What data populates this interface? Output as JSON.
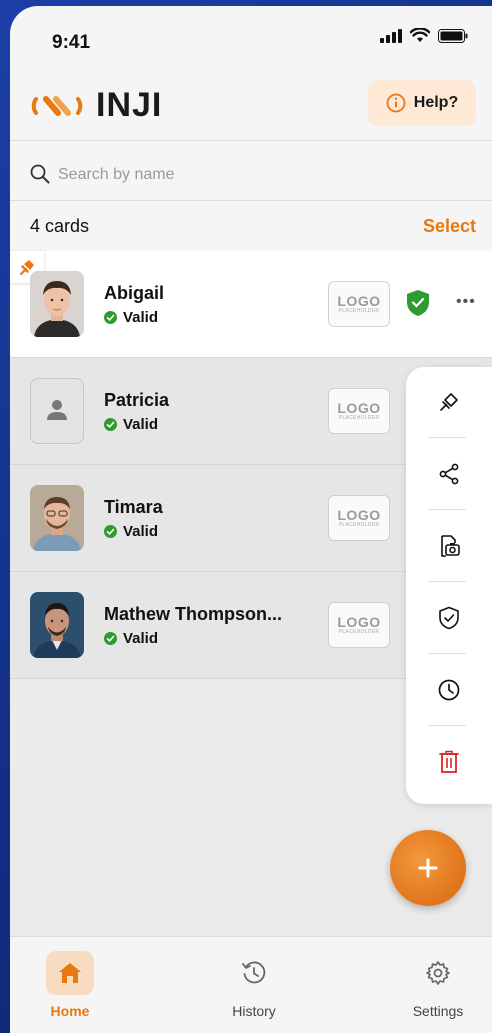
{
  "status_bar": {
    "time": "9:41"
  },
  "header": {
    "logo_text": "INJI",
    "help_label": "Help?"
  },
  "search": {
    "placeholder": "Search by name"
  },
  "cards_bar": {
    "count_label": "4 cards",
    "select_label": "Select"
  },
  "cards": [
    {
      "name": "Abigail",
      "status": "Valid",
      "logo_big": "LOGO",
      "logo_small": "PLACEHOLDER"
    },
    {
      "name": "Patricia",
      "status": "Valid",
      "logo_big": "LOGO",
      "logo_small": "PLACEHOLDER"
    },
    {
      "name": "Timara",
      "status": "Valid",
      "logo_big": "LOGO",
      "logo_small": "PLACEHOLDER"
    },
    {
      "name": "Mathew Thompson...",
      "status": "Valid",
      "logo_big": "LOGO",
      "logo_small": "PLACEHOLDER"
    }
  ],
  "menu": {
    "items": [
      "pin-icon",
      "share-icon",
      "camera-id-icon",
      "shield-check-icon",
      "clock-icon",
      "trash-icon"
    ]
  },
  "tabs": [
    {
      "label": "Home",
      "icon": "home-icon",
      "active": true
    },
    {
      "label": "History",
      "icon": "history-icon",
      "active": false
    },
    {
      "label": "Settings",
      "icon": "gear-icon",
      "active": false
    }
  ],
  "colors": {
    "accent": "#e8780f",
    "valid_green": "#2e9b2e",
    "delete_red": "#e02424"
  }
}
